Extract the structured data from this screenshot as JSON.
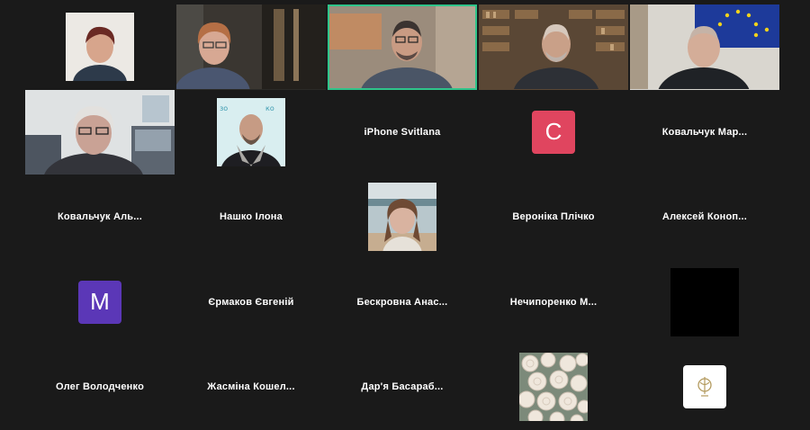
{
  "participants": [
    {
      "name": "",
      "kind": "photo"
    },
    {
      "name": "",
      "kind": "video"
    },
    {
      "name": "",
      "kind": "video",
      "active": true
    },
    {
      "name": "",
      "kind": "video"
    },
    {
      "name": "",
      "kind": "video"
    },
    {
      "name": "",
      "kind": "video"
    },
    {
      "name": "",
      "kind": "photo"
    },
    {
      "name": "iPhone Svitlana",
      "kind": "name-only"
    },
    {
      "name": "",
      "kind": "letter",
      "letter": "C",
      "color": "#e0455f"
    },
    {
      "name": "Ковальчук  Мар...",
      "kind": "name-only"
    },
    {
      "name": "Ковальчук  Аль...",
      "kind": "name-only"
    },
    {
      "name": "Нашко Ілона",
      "kind": "name-only"
    },
    {
      "name": "",
      "kind": "photo"
    },
    {
      "name": "Вероніка Плічко",
      "kind": "name-only"
    },
    {
      "name": "Алексей  Коноп...",
      "kind": "name-only"
    },
    {
      "name": "",
      "kind": "letter",
      "letter": "M",
      "color": "#5b37b7"
    },
    {
      "name": "Єрмаков Євгеній",
      "kind": "name-only"
    },
    {
      "name": "Бескровна  Анас...",
      "kind": "name-only"
    },
    {
      "name": "Нечипоренко  М...",
      "kind": "name-only"
    },
    {
      "name": "",
      "kind": "photo-black"
    },
    {
      "name": "Олег Володченко",
      "kind": "name-only"
    },
    {
      "name": "Жасміна  Кошел...",
      "kind": "name-only"
    },
    {
      "name": "Дар'я  Басараб...",
      "kind": "name-only"
    },
    {
      "name": "",
      "kind": "photo-roses"
    },
    {
      "name": "",
      "kind": "photo-logo"
    }
  ]
}
